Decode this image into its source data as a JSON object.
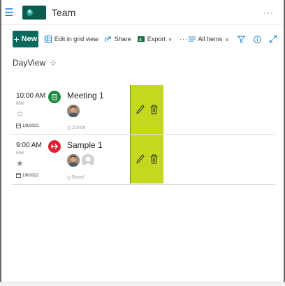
{
  "header": {
    "site_title": "Team",
    "logo_text": "s",
    "more_label": "···"
  },
  "commandbar": {
    "new_label": "New",
    "edit_grid_label": "Edit in grid view",
    "share_label": "Share",
    "export_label": "Export",
    "more_label": "···",
    "view_label": "All Items"
  },
  "page": {
    "title": "DayView",
    "favorite_symbol": "☆"
  },
  "items": [
    {
      "time": "10:00 AM",
      "duration": "60m",
      "star": "☆",
      "date": "1/9/2022",
      "icon": "building-icon",
      "icon_color": "#1b8a3e",
      "title": "Meeting 1",
      "location": "Zürich",
      "attendees": [
        "photo"
      ]
    },
    {
      "time": "9:00 AM",
      "duration": "59m",
      "star": "★",
      "date": "1/8/2022",
      "icon": "airplane-icon",
      "icon_color": "#e02032",
      "title": "Sample 1",
      "location": "Basel",
      "attendees": [
        "photo",
        "placeholder"
      ]
    }
  ],
  "colors": {
    "accent": "#0b6a5d",
    "actions_bg": "#c2d91d",
    "brand_blue": "#0078d4"
  }
}
